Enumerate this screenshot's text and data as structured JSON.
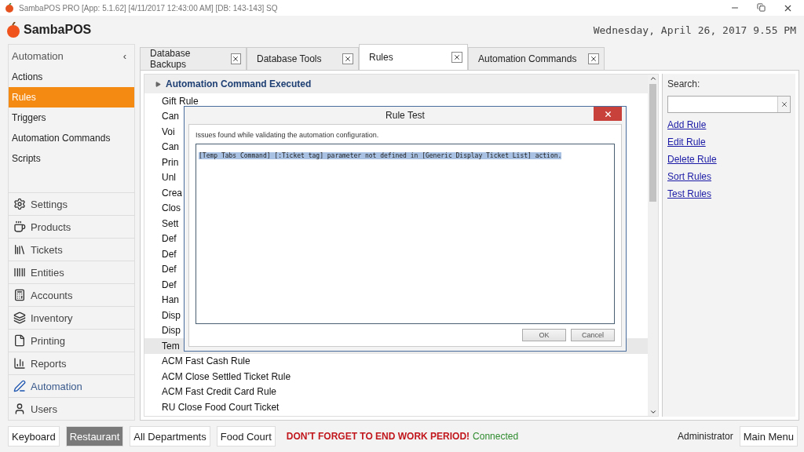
{
  "window": {
    "title": "SambaPOS PRO [App: 5.1.62] [4/11/2017 12:43:00 AM] [DB: 143-143] SQ"
  },
  "header": {
    "logo": "SambaPOS",
    "datetime": "Wednesday, April 26, 2017 9.55 PM"
  },
  "sidebar": {
    "title": "Automation",
    "collapse": "‹",
    "items": [
      {
        "label": "Actions",
        "selected": false
      },
      {
        "label": "Rules",
        "selected": true
      },
      {
        "label": "Triggers",
        "selected": false
      },
      {
        "label": "Automation Commands",
        "selected": false
      },
      {
        "label": "Scripts",
        "selected": false
      }
    ],
    "nav": [
      {
        "label": "Settings",
        "selected": false
      },
      {
        "label": "Products",
        "selected": false
      },
      {
        "label": "Tickets",
        "selected": false
      },
      {
        "label": "Entities",
        "selected": false
      },
      {
        "label": "Accounts",
        "selected": false
      },
      {
        "label": "Inventory",
        "selected": false
      },
      {
        "label": "Printing",
        "selected": false
      },
      {
        "label": "Reports",
        "selected": false
      },
      {
        "label": "Automation",
        "selected": true
      },
      {
        "label": "Users",
        "selected": false
      }
    ]
  },
  "tabs": [
    {
      "label": "Database Backups",
      "selected": false
    },
    {
      "label": "Database Tools",
      "selected": false
    },
    {
      "label": "Rules",
      "selected": true
    },
    {
      "label": "Automation Commands",
      "selected": false
    }
  ],
  "rules": {
    "group": "Automation Command Executed",
    "rows": [
      {
        "label": "Gift Rule",
        "selected": false
      },
      {
        "label": "Can",
        "selected": false
      },
      {
        "label": "Voi",
        "selected": false
      },
      {
        "label": "Can",
        "selected": false
      },
      {
        "label": "Prin",
        "selected": false
      },
      {
        "label": "Unl",
        "selected": false
      },
      {
        "label": "Crea",
        "selected": false
      },
      {
        "label": "Clos",
        "selected": false
      },
      {
        "label": "Sett",
        "selected": false
      },
      {
        "label": "Def",
        "selected": false
      },
      {
        "label": "Def",
        "selected": false
      },
      {
        "label": "Def",
        "selected": false
      },
      {
        "label": "Def",
        "selected": false
      },
      {
        "label": "Han",
        "selected": false
      },
      {
        "label": "Disp",
        "selected": false
      },
      {
        "label": "Disp",
        "selected": false
      },
      {
        "label": "Tem",
        "selected": true
      },
      {
        "label": "ACM Fast Cash Rule",
        "selected": false
      },
      {
        "label": "ACM Close Settled Ticket Rule",
        "selected": false
      },
      {
        "label": "ACM Fast Credit Card Rule",
        "selected": false
      },
      {
        "label": "RU Close Food Court Ticket",
        "selected": false
      }
    ]
  },
  "side_panel": {
    "search_label": "Search:",
    "links": [
      "Add Rule",
      "Edit Rule",
      "Delete Rule",
      "Sort Rules",
      "Test Rules"
    ]
  },
  "dialog": {
    "title": "Rule Test",
    "message": "Issues found while validating the automation configuration.",
    "details": "[Temp Tabs Command] [:Ticket tag] parameter not defined in [Generic Display Ticket List] action.",
    "buttons": [
      "OK",
      "Cancel"
    ]
  },
  "status_bar": {
    "buttons": [
      {
        "label": "Keyboard",
        "selected": false
      },
      {
        "label": "Restaurant",
        "selected": true
      },
      {
        "label": "All Departments",
        "selected": false
      },
      {
        "label": "Food Court",
        "selected": false
      }
    ],
    "warning": "DON'T FORGET TO END WORK PERIOD!",
    "connection": "Connected",
    "user": "Administrator",
    "menu": "Main Menu"
  }
}
